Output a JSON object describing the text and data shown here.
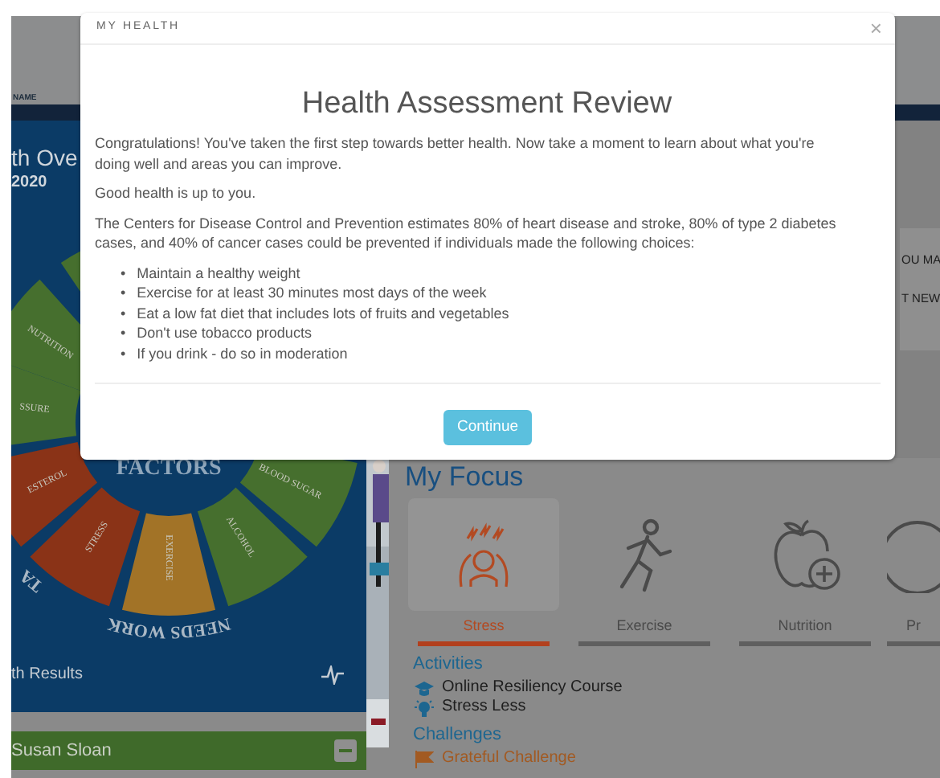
{
  "header": {
    "label": "NAME"
  },
  "overview": {
    "title": "th Ove",
    "year": "2020",
    "wheel": {
      "center_label": "FACTORS",
      "ring_labels": [
        "NEEDS WORK",
        "TA"
      ],
      "segments": [
        {
          "color": "#466f2e"
        },
        {
          "label": "NUTRITION",
          "color": "#466f2e"
        },
        {
          "label": "SSURE",
          "color": "#466f2e"
        },
        {
          "label": "ESTEROL",
          "color": "#8a3317"
        },
        {
          "label": "STRESS",
          "color": "#8a3317"
        },
        {
          "label": "EXERCISE",
          "color": "#a27327"
        },
        {
          "label": "ALCOHOL",
          "color": "#466f2e"
        },
        {
          "label": "BLOOD SUGAR",
          "color": "#466f2e"
        }
      ]
    },
    "results_link": "th Results"
  },
  "member": {
    "name": "Susan Sloan",
    "expanded": true
  },
  "notices": [
    "OU MA",
    "T NEW"
  ],
  "focus": {
    "title": "My Focus",
    "items": [
      {
        "label": "Stress",
        "selected": true
      },
      {
        "label": "Exercise",
        "selected": false
      },
      {
        "label": "Nutrition",
        "selected": false
      },
      {
        "label": "Pr",
        "selected": false
      }
    ]
  },
  "activities": {
    "title": "Activities",
    "items": [
      "Online Resiliency Course",
      "Stress Less"
    ]
  },
  "challenges": {
    "title": "Challenges",
    "items": [
      "Grateful Challenge"
    ]
  },
  "modal": {
    "eyebrow": "MY HEALTH",
    "close": "×",
    "title": "Health Assessment Review",
    "paragraphs": [
      "Congratulations! You've taken the first step towards better health. Now take a moment to learn about what you're doing well and areas you can improve.",
      "Good health is up to you.",
      "The Centers for Disease Control and Prevention estimates 80% of heart disease and stroke, 80% of type 2 diabetes cases, and 40% of cancer cases could be prevented if individuals made the following choices:"
    ],
    "bullet_marker": "•",
    "bullets": [
      "Maintain a healthy weight",
      "Exercise for at least 30 minutes most days of the week",
      "Eat a low fat diet that includes lots of fruits and vegetables",
      "Don't use tobacco products",
      "If you drink - do so in moderation"
    ],
    "button": "Continue"
  }
}
